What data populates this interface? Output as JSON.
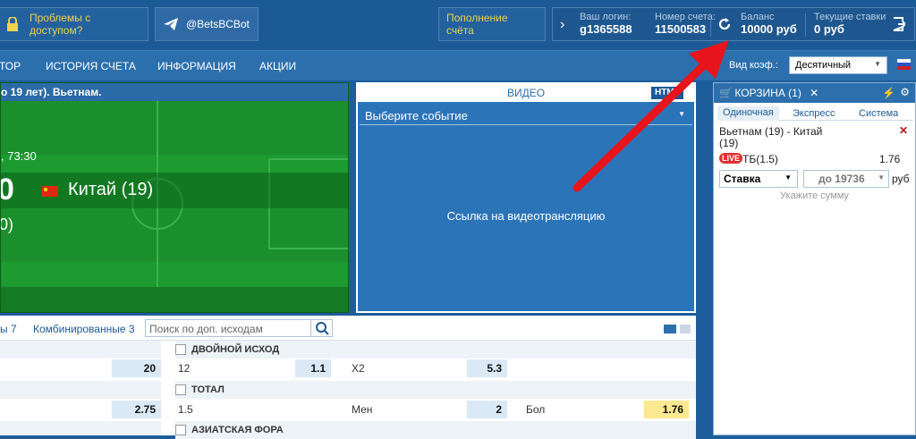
{
  "topbar": {
    "access_problems": "Проблемы с доступом?",
    "bot": "@BetsBCBot",
    "deposit": "Пополнение счёта",
    "login_label": "Ваш логин:",
    "login_value": "g1365588",
    "account_label": "Номер счета:",
    "account_value": "11500583",
    "balance_label": "Баланс",
    "balance_value": "10000 руб",
    "bets_label": "Текущие ставки",
    "bets_value": "0 руб"
  },
  "nav": {
    "items": [
      "ТОР",
      "ИСТОРИЯ СЧЕТА",
      "ИНФОРМАЦИЯ",
      "АКЦИИ"
    ],
    "odds_label": "Вид коэф.:",
    "odds_value": "Десятичный"
  },
  "match": {
    "title": "о 19 лет). Вьетнам.",
    "time": ", 73:30",
    "score": "0",
    "team": "Китай (19)",
    "sub": "0)"
  },
  "video": {
    "title": "ВИДЕО",
    "badge": "HTML",
    "select_placeholder": "Выберите событие",
    "link_text": "Ссылка на видеотрансляцию"
  },
  "betslip": {
    "title": "КОРЗИНА (1)",
    "tabs": [
      "Одиночная",
      "Экспресс",
      "Система"
    ],
    "event": "Вьетнам (19) - Китай (19)",
    "live": "LIVE",
    "bet_type": "ТБ(1.5)",
    "odds": "1.76",
    "stake_label": "Ставка",
    "stake_placeholder": "до 19736",
    "currency": "руб",
    "hint": "Укажите сумму"
  },
  "markets": {
    "tabs": [
      "ы 7",
      "Комбинированные 3"
    ],
    "search_placeholder": "Поиск по доп. исходам",
    "row1_val": "20",
    "row2_val": "2.75",
    "double": {
      "title": "ДВОЙНОЙ ИСХОД",
      "a_label": "12",
      "a_val": "1.1",
      "b_label": "X2",
      "b_val": "5.3"
    },
    "total": {
      "title": "ТОТАЛ",
      "line": "1.5",
      "under_label": "Мен",
      "under_val": "2",
      "over_label": "Бол",
      "over_val": "1.76"
    },
    "asian_title": "АЗИАТСКАЯ ФОРА"
  },
  "colors": {
    "accent_yellow": "#f0d24b",
    "arrow_red": "#e8141b"
  }
}
